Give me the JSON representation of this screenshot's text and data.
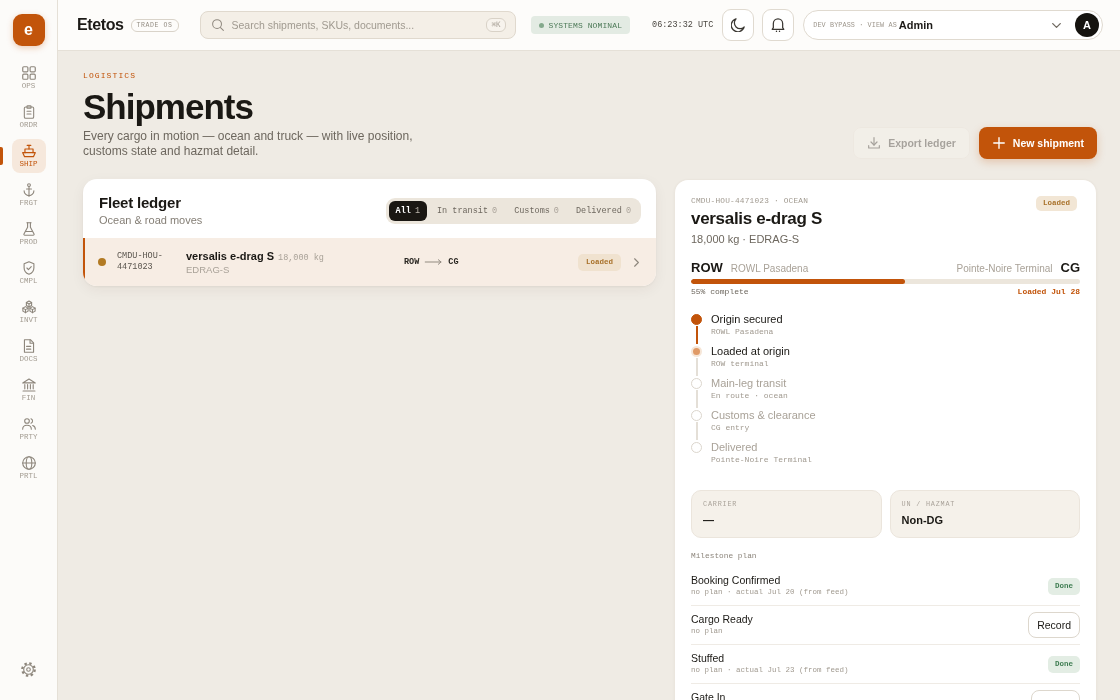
{
  "sidebar": {
    "logo": "e",
    "items": [
      {
        "label": "OPS",
        "selected": false
      },
      {
        "label": "ORDR",
        "selected": false
      },
      {
        "label": "SHIP",
        "selected": true
      },
      {
        "label": "FRGT",
        "selected": false
      },
      {
        "label": "PROD",
        "selected": false
      },
      {
        "label": "CMPL",
        "selected": false
      },
      {
        "label": "INVT",
        "selected": false
      },
      {
        "label": "DOCS",
        "selected": false
      },
      {
        "label": "FIN",
        "selected": false
      },
      {
        "label": "PRTY",
        "selected": false
      },
      {
        "label": "PRTL",
        "selected": false
      }
    ]
  },
  "topbar": {
    "brand": "Etetos",
    "tag": "TRADE OS",
    "search": {
      "placeholder": "Search shipments, SKUs, documents...",
      "shortcut": "⌘K"
    },
    "system_status": "SYSTEMS NOMINAL",
    "clock": "06:23:32 UTC",
    "user": {
      "prefix": "DEV BYPASS · VIEW AS",
      "name": "Admin",
      "initial": "A"
    }
  },
  "header": {
    "eyebrow": "LOGISTICS",
    "title": "Shipments",
    "description": "Every cargo in motion — ocean and truck — with live position, customs state and hazmat detail.",
    "actions": [
      {
        "label": "Export ledger",
        "kind": "secondary",
        "disabled": true
      },
      {
        "label": "New shipment",
        "kind": "primary",
        "disabled": false
      }
    ]
  },
  "ledger": {
    "title": "Fleet ledger",
    "subtitle": "Ocean & road moves",
    "filters": [
      {
        "label": "All",
        "count": "1",
        "selected": true
      },
      {
        "label": "In transit",
        "count": "0",
        "selected": false
      },
      {
        "label": "Customs",
        "count": "0",
        "selected": false
      },
      {
        "label": "Delivered",
        "count": "0",
        "selected": false
      }
    ],
    "rows": [
      {
        "id": "CMDU-HOU-4471023",
        "name": "versalis e-drag S",
        "weight": "18,000 kg",
        "sku": "EDRAG-S",
        "origin": "ROW",
        "destination": "CG",
        "status": "Loaded",
        "color": "#b27a23",
        "selected": true
      }
    ]
  },
  "detail": {
    "reference": "CMDU-HOU-4471023 · OCEAN",
    "status": "Loaded",
    "title": "versalis e-drag S",
    "summary": "18,000 kg · EDRAG-S",
    "origin": {
      "code": "ROW",
      "place": "ROWL Pasadena"
    },
    "destination": {
      "code": "CG",
      "place": "Pointe-Noire Terminal"
    },
    "progress": {
      "level": 0.55,
      "label": "55% complete",
      "status": "Loaded Jul 28"
    },
    "timeline": [
      {
        "title": "Origin secured",
        "detail": "ROWL Pasadena",
        "done": true,
        "current": false
      },
      {
        "title": "Loaded at origin",
        "detail": "ROW terminal",
        "done": false,
        "current": true
      },
      {
        "title": "Main-leg transit",
        "detail": "En route · ocean",
        "done": false,
        "current": false
      },
      {
        "title": "Customs & clearance",
        "detail": "CG entry",
        "done": false,
        "current": false
      },
      {
        "title": "Delivered",
        "detail": "Pointe-Noire Terminal",
        "done": false,
        "current": false
      }
    ],
    "facts": [
      {
        "label": "CARRIER",
        "value": "—"
      },
      {
        "label": "UN / HAZMAT",
        "value": "Non-DG"
      }
    ],
    "milestones_label": "Milestone plan",
    "milestones": [
      {
        "title": "Booking Confirmed",
        "detail": "no plan · actual Jul 20 (from feed)",
        "kind": "done",
        "action": "Done"
      },
      {
        "title": "Cargo Ready",
        "detail": "no plan",
        "kind": "record",
        "action": "Record"
      },
      {
        "title": "Stuffed",
        "detail": "no plan · actual Jul 23 (from feed)",
        "kind": "done",
        "action": "Done"
      },
      {
        "title": "Gate In",
        "kind": "record"
      }
    ]
  }
}
